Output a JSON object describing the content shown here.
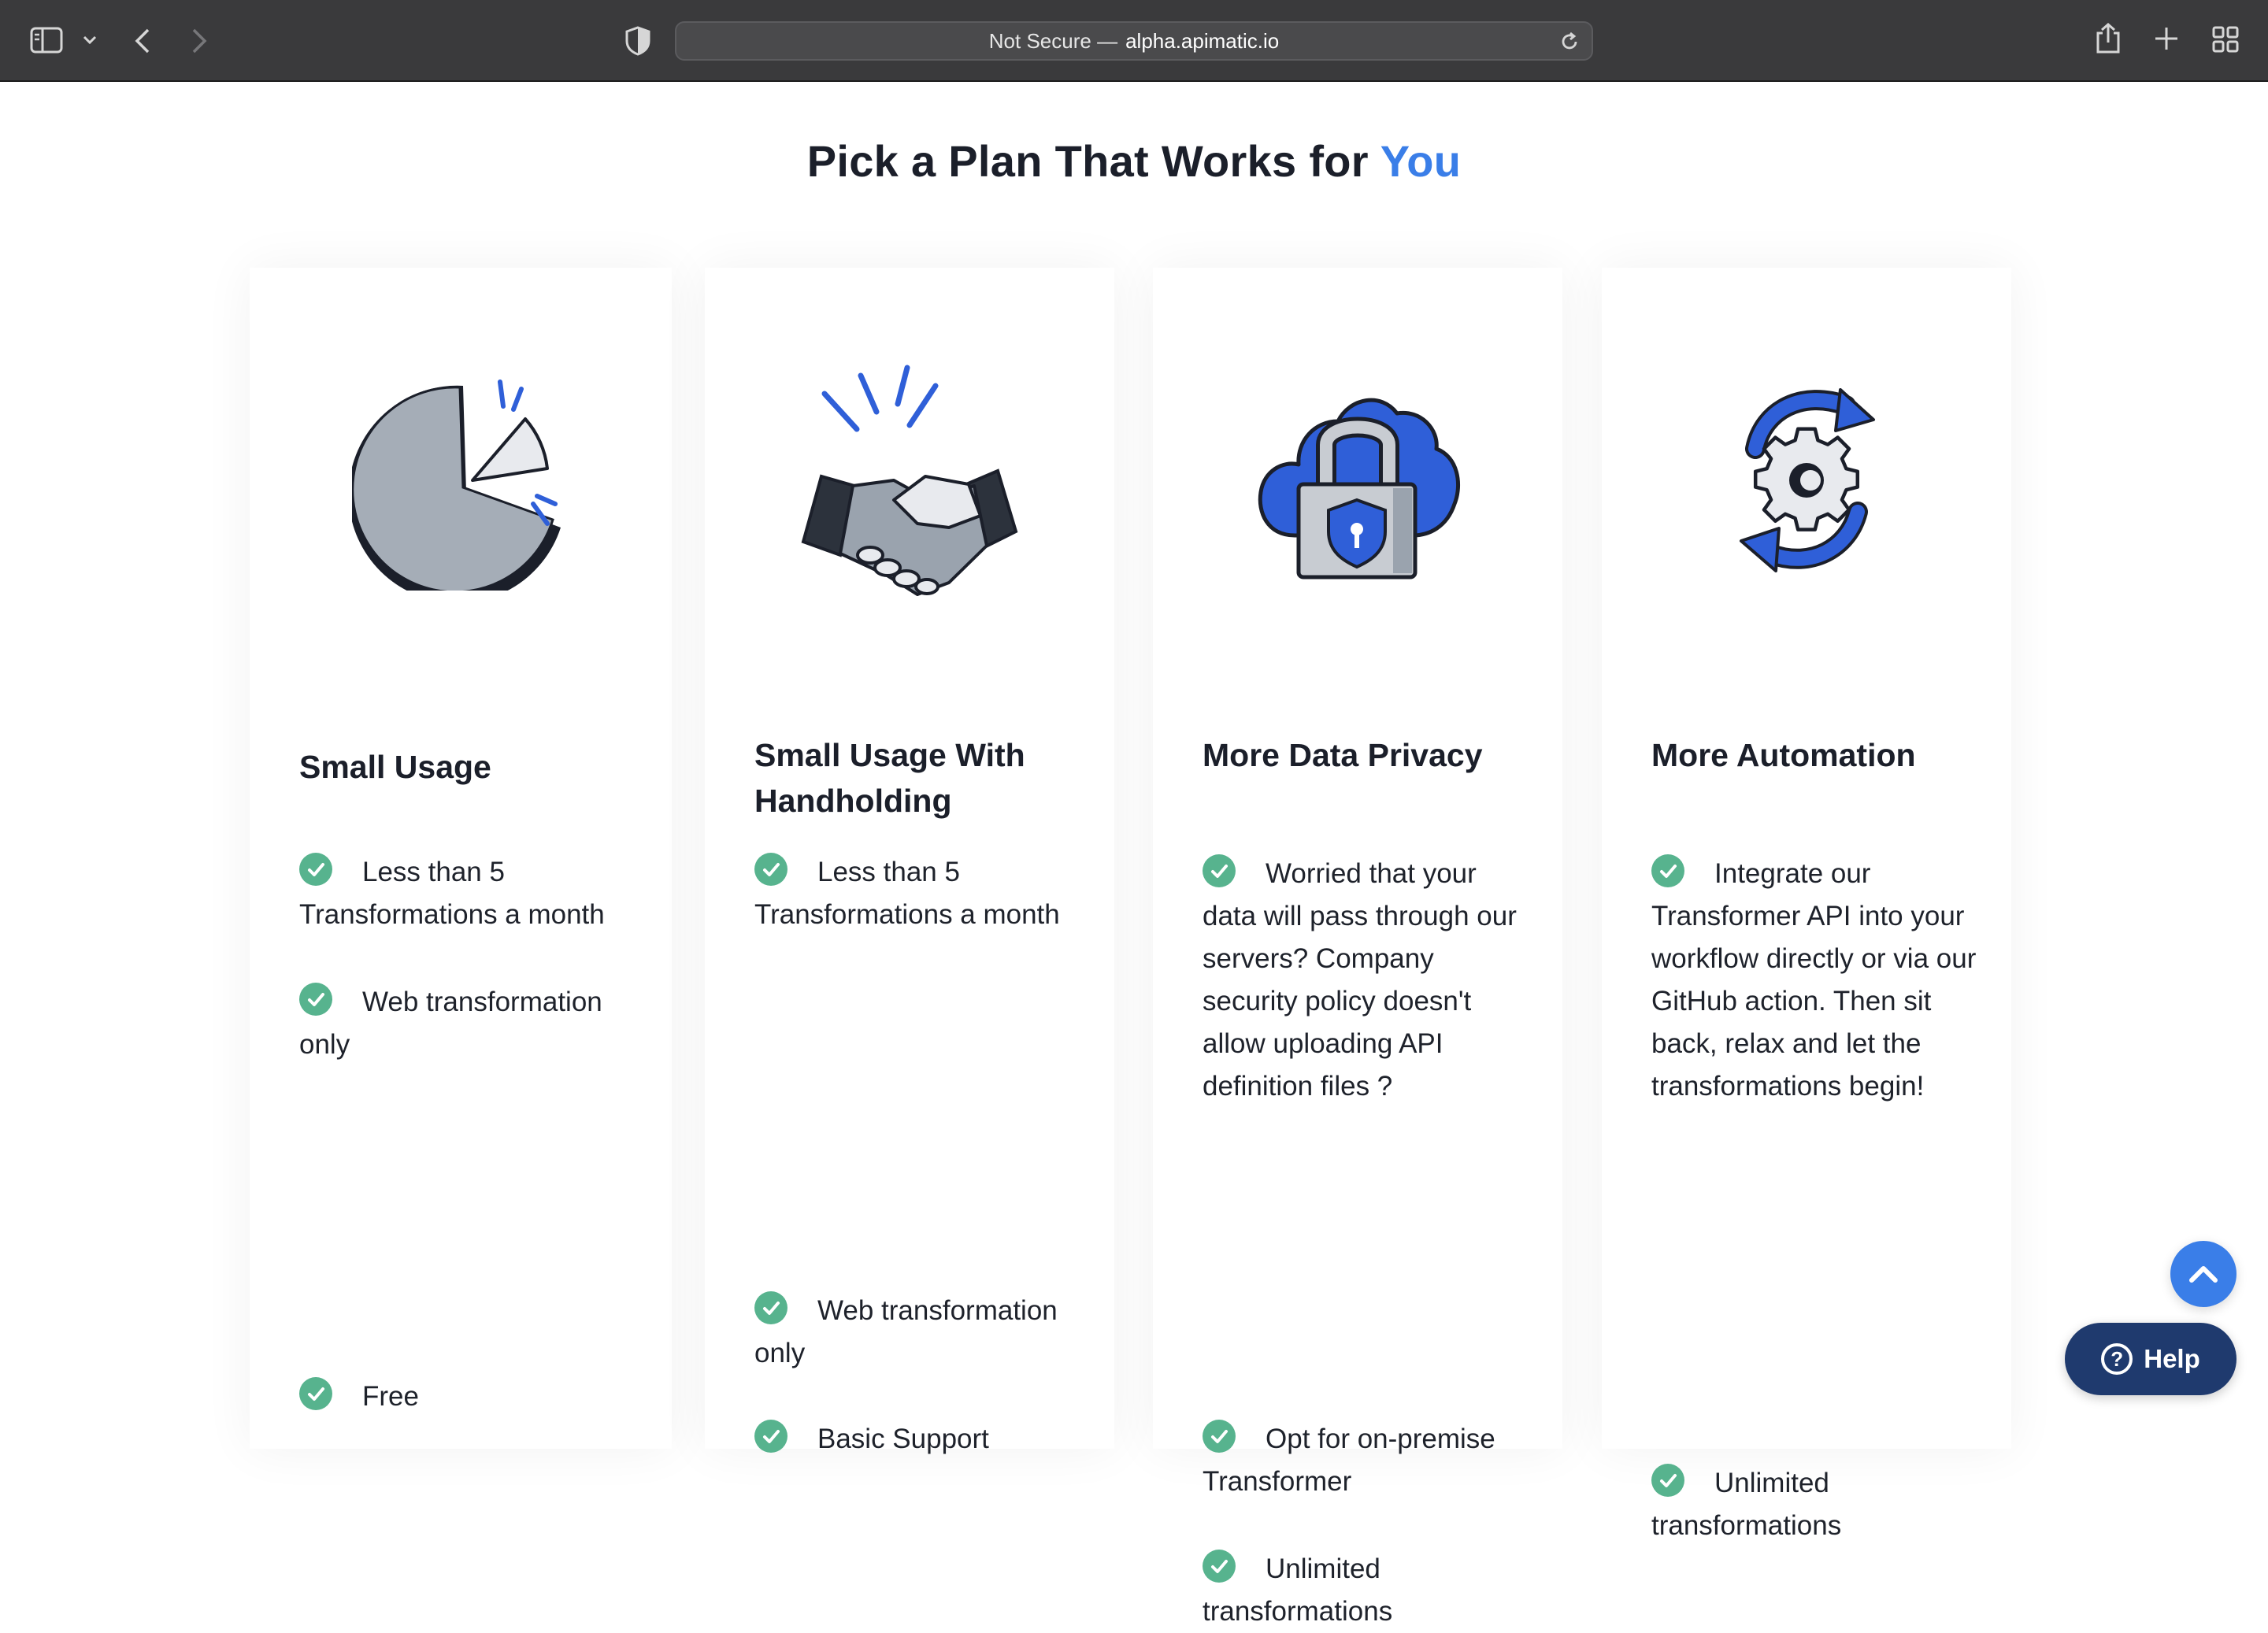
{
  "browser": {
    "address": {
      "prefix": "Not Secure —",
      "host": "alpha.apimatic.io"
    }
  },
  "page": {
    "title_main": "Pick a Plan That Works for",
    "title_accent": "You",
    "accent_color": "#3a7ee8",
    "check_color": "#57b38e"
  },
  "plans": [
    {
      "heading": "Small Usage",
      "icon": "pie-chart-icon",
      "features": [
        "Less than 5 Transformations a month",
        "Web transformation only",
        "Free"
      ]
    },
    {
      "heading": "Small Usage With Handholding",
      "icon": "handshake-icon",
      "features": [
        "Less than 5 Transformations a month",
        "Web transformation only",
        "Basic Support"
      ]
    },
    {
      "heading": "More Data Privacy",
      "icon": "cloud-lock-icon",
      "features": [
        "Worried that your data will pass through our servers? Company security policy doesn't allow uploading API definition files ?",
        "Opt for on-premise Transformer",
        "Unlimited transformations"
      ]
    },
    {
      "heading": "More Automation",
      "icon": "gear-sync-icon",
      "features": [
        "Integrate our Transformer API into your workflow directly or via our GitHub action. Then sit back, relax and let the transformations begin!",
        "Unlimited transformations"
      ]
    }
  ],
  "help": {
    "label": "Help"
  }
}
